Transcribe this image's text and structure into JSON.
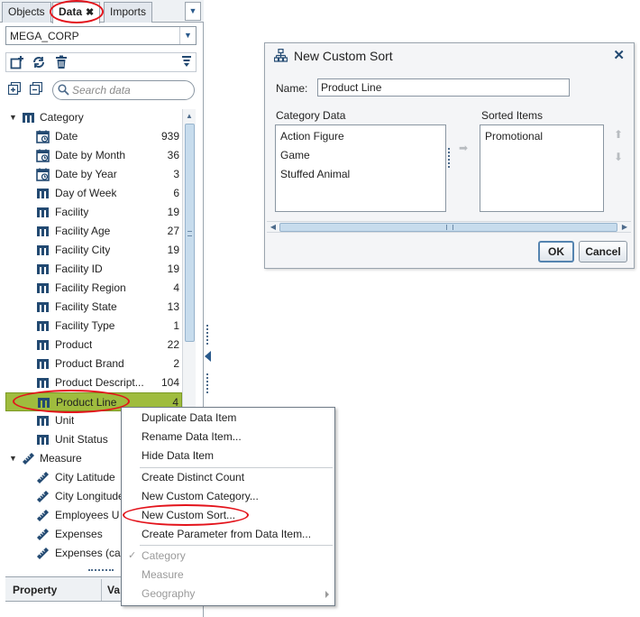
{
  "tabs": [
    {
      "label": "Objects",
      "active": false
    },
    {
      "label": "Data",
      "active": true,
      "close_glyph": "✖"
    },
    {
      "label": "Imports",
      "active": false
    }
  ],
  "tab_menu_glyph": "▼",
  "data_source": {
    "value": "MEGA_CORP",
    "arrow": "▼"
  },
  "toolbar_icons": [
    "new-data-item-icon",
    "refresh-icon",
    "delete-icon",
    "filter-icon"
  ],
  "search": {
    "placeholder": "Search data"
  },
  "tree": {
    "category_group": {
      "label": "Category",
      "expanded": true
    },
    "items": [
      {
        "label": "Date",
        "count": "939",
        "icon": "date-icon"
      },
      {
        "label": "Date by Month",
        "count": "36",
        "icon": "date-icon"
      },
      {
        "label": "Date by Year",
        "count": "3",
        "icon": "date-icon"
      },
      {
        "label": "Day of Week",
        "count": "6",
        "icon": "category-icon"
      },
      {
        "label": "Facility",
        "count": "19",
        "icon": "category-icon"
      },
      {
        "label": "Facility Age",
        "count": "27",
        "icon": "category-icon"
      },
      {
        "label": "Facility City",
        "count": "19",
        "icon": "category-icon"
      },
      {
        "label": "Facility ID",
        "count": "19",
        "icon": "category-icon"
      },
      {
        "label": "Facility Region",
        "count": "4",
        "icon": "category-icon"
      },
      {
        "label": "Facility State",
        "count": "13",
        "icon": "category-icon"
      },
      {
        "label": "Facility Type",
        "count": "1",
        "icon": "category-icon"
      },
      {
        "label": "Product",
        "count": "22",
        "icon": "category-icon"
      },
      {
        "label": "Product Brand",
        "count": "2",
        "icon": "category-icon"
      },
      {
        "label": "Product Descript...",
        "count": "104",
        "icon": "category-icon"
      },
      {
        "label": "Product Line",
        "count": "4",
        "icon": "category-icon",
        "selected": true
      },
      {
        "label": "Unit",
        "count": "",
        "icon": "category-icon"
      },
      {
        "label": "Unit Status",
        "count": "",
        "icon": "category-icon"
      }
    ],
    "measure_group": {
      "label": "Measure",
      "expanded": true
    },
    "measures": [
      {
        "label": "City Latitude",
        "icon": "measure-icon"
      },
      {
        "label": "City Longitude",
        "icon": "measure-icon"
      },
      {
        "label": "Employees U",
        "icon": "measure-icon"
      },
      {
        "label": "Expenses",
        "icon": "measure-icon"
      },
      {
        "label": "Expenses (ca",
        "icon": "measure-icon"
      }
    ]
  },
  "properties_table": {
    "col1": "Property",
    "col2": "Va"
  },
  "context_menu": {
    "items": [
      {
        "label": "Duplicate Data Item",
        "enabled": true
      },
      {
        "label": "Rename Data Item...",
        "enabled": true
      },
      {
        "label": "Hide Data Item",
        "enabled": true
      },
      {
        "label": "Create Distinct Count",
        "enabled": true
      },
      {
        "label": "New Custom Category...",
        "enabled": true
      },
      {
        "label": "New Custom Sort...",
        "enabled": true,
        "highlighted": true
      },
      {
        "label": "Create Parameter from Data Item...",
        "enabled": true
      },
      {
        "label": "Category",
        "enabled": false,
        "checked": true
      },
      {
        "label": "Measure",
        "enabled": false
      },
      {
        "label": "Geography",
        "enabled": false,
        "has_submenu": true
      }
    ],
    "check_glyph": "✓"
  },
  "dialog": {
    "title": "New Custom Sort",
    "close_glyph": "✕",
    "name_label": "Name:",
    "name_value": "Product Line",
    "category_data_label": "Category Data",
    "category_data_items": [
      "Action Figure",
      "Game",
      "Stuffed Animal"
    ],
    "sorted_items_label": "Sorted Items",
    "sorted_items": [
      "Promotional"
    ],
    "move_right_glyph": "➡",
    "move_up_glyph": "⬆",
    "move_down_glyph": "⬇",
    "ok_label": "OK",
    "cancel_label": "Cancel"
  },
  "scroll_glyphs": {
    "up": "▲",
    "down": "▼",
    "left": "◀",
    "right": "▶"
  },
  "colors": {
    "selection_green": "#9fbc3e",
    "highlight_red": "#e3131b",
    "icon_blue": "#234a72",
    "ok_border": "#5584b0"
  }
}
